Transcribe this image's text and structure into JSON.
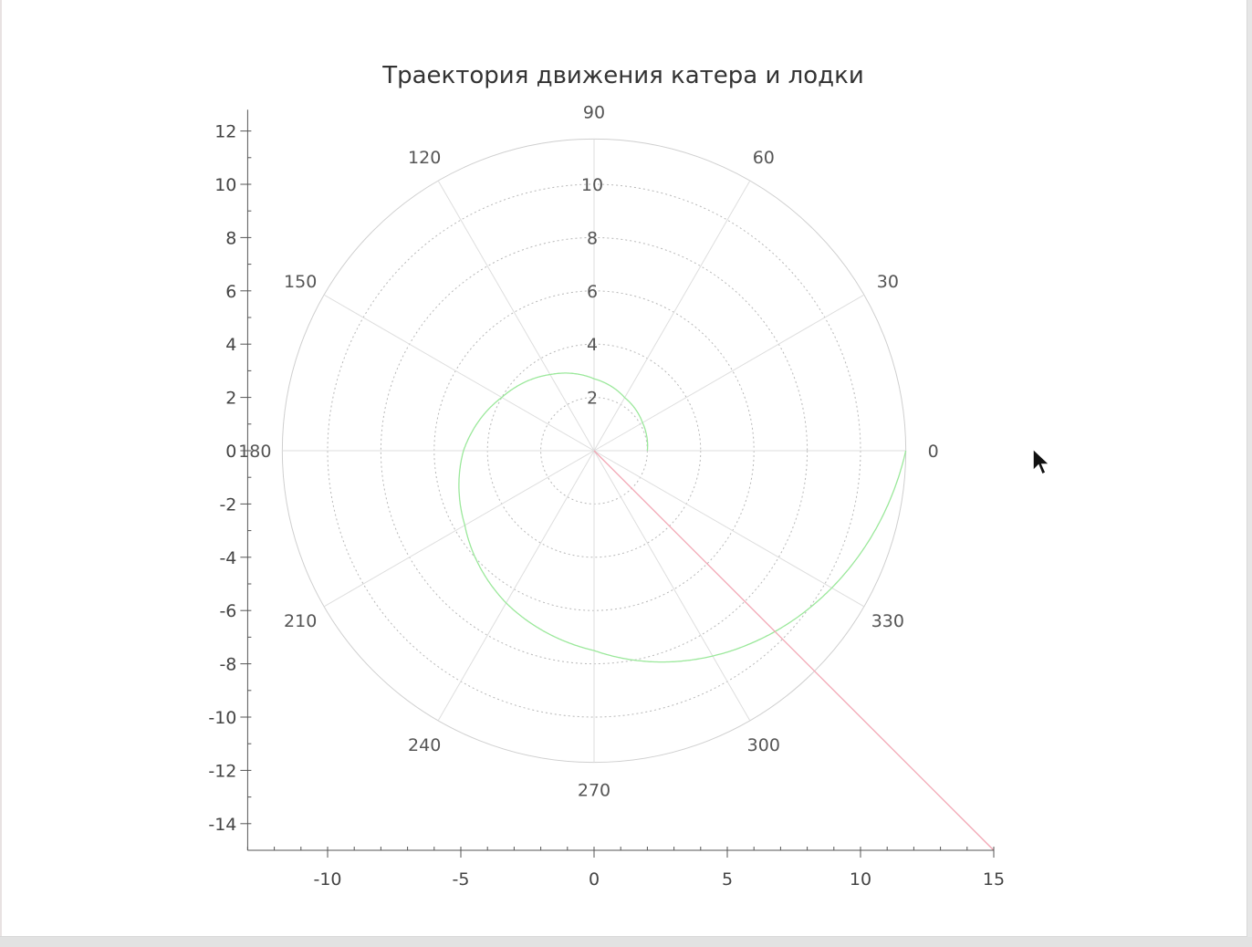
{
  "chart_data": {
    "type": "polar",
    "title": "Траектория движения катера и лодки",
    "x_ticks": [
      "-10",
      "-5",
      "0",
      "5",
      "10",
      "15"
    ],
    "y_ticks": [
      "12",
      "10",
      "8",
      "6",
      "4",
      "2",
      "0",
      "-2",
      "-4",
      "-6",
      "-8",
      "-10",
      "-12",
      "-14"
    ],
    "xlim": [
      -13,
      15
    ],
    "ylim": [
      -15,
      12.8
    ],
    "polar_grid": {
      "rmax": 11.7,
      "radial_ticks": [
        "2",
        "4",
        "6",
        "8",
        "10"
      ],
      "angle_ticks": [
        "0",
        "30",
        "60",
        "90",
        "120",
        "150",
        "180",
        "210",
        "240",
        "270",
        "300",
        "330"
      ]
    },
    "series": [
      {
        "color": "#9be89b",
        "kind": "spiral",
        "r0_over_theta": "r = 2·exp(θ/(2π)) approx",
        "points_polar": [
          [
            0,
            2.0
          ],
          [
            30,
            2.1
          ],
          [
            60,
            2.3
          ],
          [
            90,
            2.7
          ],
          [
            120,
            3.3
          ],
          [
            150,
            4.0
          ],
          [
            180,
            4.9
          ],
          [
            210,
            5.6
          ],
          [
            240,
            6.6
          ],
          [
            270,
            7.5
          ],
          [
            300,
            8.9
          ],
          [
            330,
            10.3
          ],
          [
            360,
            11.7
          ]
        ]
      },
      {
        "color": "#f2a6b3",
        "kind": "ray",
        "points_xy": [
          [
            0,
            0
          ],
          [
            15,
            -15
          ]
        ]
      }
    ],
    "grid": true
  },
  "colors": {
    "axis": "#555555",
    "grid": "#cfcfcf",
    "spiral": "#9be89b",
    "ray": "#f2a6b3"
  },
  "icons": {
    "cursor": "mouse-pointer-icon"
  }
}
